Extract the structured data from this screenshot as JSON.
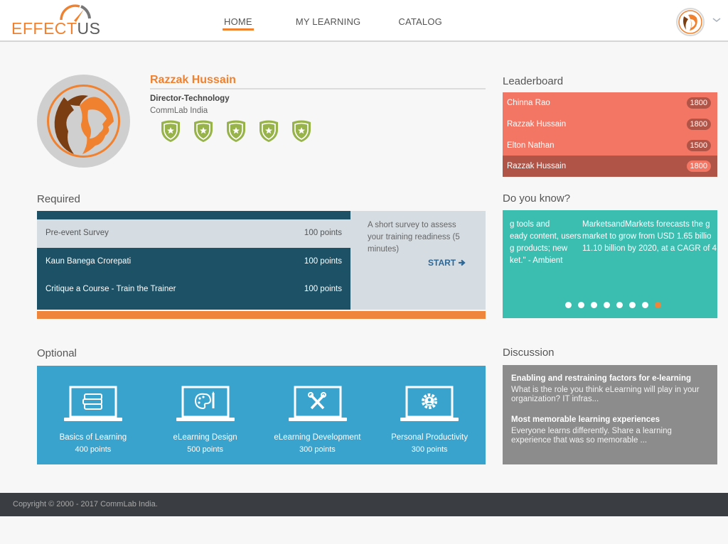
{
  "brand": {
    "name_part1": "EFFECT",
    "name_part2": "US",
    "accent": "#f0812f"
  },
  "nav": {
    "items": [
      {
        "label": "HOME",
        "active": true
      },
      {
        "label": "MY LEARNING",
        "active": false
      },
      {
        "label": "CATALOG",
        "active": false
      }
    ]
  },
  "profile": {
    "name": "Razzak Hussain",
    "title": "Director-Technology",
    "company": "CommLab India",
    "badge_count": 5
  },
  "required": {
    "heading": "Required",
    "items": [
      {
        "title": "Pre-event Survey",
        "points": "100 points",
        "selected": true
      },
      {
        "title": "Kaun Banega Crorepati",
        "points": "100 points",
        "selected": false
      },
      {
        "title": "Critique a Course - Train the Trainer",
        "points": "100 points",
        "selected": false
      }
    ],
    "detail": {
      "description": "A short survey to assess your training readiness (5 minutes)",
      "action_label": "START",
      "action_icon": "arrow-right-icon"
    }
  },
  "optional": {
    "heading": "Optional",
    "items": [
      {
        "title": "Basics of Learning",
        "points": "400 points",
        "icon": "books-icon"
      },
      {
        "title": "eLearning Design",
        "points": "500 points",
        "icon": "palette-icon"
      },
      {
        "title": "eLearning Development",
        "points": "300 points",
        "icon": "tools-icon"
      },
      {
        "title": "Personal Productivity",
        "points": "300 points",
        "icon": "gear-person-icon"
      }
    ]
  },
  "leaderboard": {
    "heading": "Leaderboard",
    "rows": [
      {
        "name": "Chinna Rao",
        "score": "1800",
        "current_user": false
      },
      {
        "name": "Razzak Hussain",
        "score": "1800",
        "current_user": false
      },
      {
        "name": "Elton Nathan",
        "score": "1500",
        "current_user": false
      },
      {
        "name": "Razzak Hussain",
        "score": "1800",
        "current_user": true
      }
    ]
  },
  "do_you_know": {
    "heading": "Do you know?",
    "prev_slide_lines": [
      "g tools and",
      "eady content, users",
      "g products; new",
      "ket.\" - Ambient"
    ],
    "current_slide_lines": [
      "MarketsandMarkets forecasts the g",
      "market to grow from USD 1.65 billio",
      "11.10 billion by 2020, at a CAGR of 4"
    ],
    "slide_count": 8,
    "active_slide": 8
  },
  "discussion": {
    "heading": "Discussion",
    "items": [
      {
        "title": "Enabling and restraining factors for e-learning",
        "excerpt": "What is the role you think eLearning will play in your organization? IT infras..."
      },
      {
        "title": "Most memorable learning experiences",
        "excerpt": "Everyone learns differently. Share a learning experience that was so memorable ..."
      }
    ]
  },
  "footer": {
    "copyright": "Copyright © 2000 - 2017 CommLab India."
  }
}
